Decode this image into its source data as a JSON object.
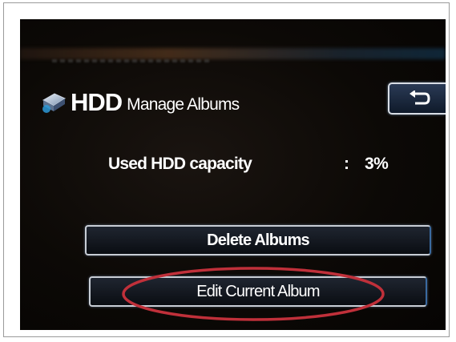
{
  "header": {
    "hdd_label": "HDD",
    "title": "Manage Albums",
    "back_icon": "return-arrow-icon",
    "hdd_icon": "hdd-drive-icon"
  },
  "capacity": {
    "label": "Used HDD capacity",
    "separator": ":",
    "value": "3%"
  },
  "menu": {
    "delete_label": "Delete Albums",
    "edit_label": "Edit Current Album"
  },
  "annotation": {
    "color": "#c0303a",
    "target": "Edit Current Album"
  }
}
